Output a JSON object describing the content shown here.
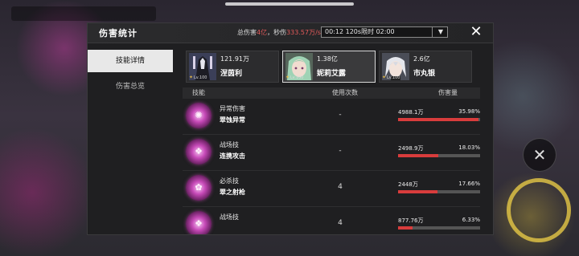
{
  "header": {
    "title": "伤害统计",
    "total_damage_label": "总伤害",
    "total_damage_value": "4亿",
    "dps_label": "，秒伤",
    "dps_value": "333.57万/s",
    "timer_option": "00:12 120s限时 02:00"
  },
  "sidebar": {
    "items": [
      {
        "label": "技能详情",
        "active": true
      },
      {
        "label": "伤害总览",
        "active": false
      }
    ]
  },
  "characters": [
    {
      "damage": "121.91万",
      "name": "涅茵利",
      "level": "Lv.100"
    },
    {
      "damage": "1.38亿",
      "name": "妮莉艾露",
      "level": "Lv.100"
    },
    {
      "damage": "2.6亿",
      "name": "市丸银",
      "level": "Lv.100"
    }
  ],
  "table": {
    "headers": {
      "skill": "技能",
      "uses": "使用次数",
      "damage": "伤害量"
    },
    "rows": [
      {
        "type": "异常伤害",
        "name": "翠蚀异常",
        "uses": "-",
        "damage": "4988.1万",
        "percent": "35.98%",
        "share": 0.3598
      },
      {
        "type": "战场技",
        "name": "连携攻击",
        "uses": "-",
        "damage": "2498.9万",
        "percent": "18.03%",
        "share": 0.1803
      },
      {
        "type": "必杀技",
        "name": "翠之射枪",
        "uses": "4",
        "damage": "2448万",
        "percent": "17.66%",
        "share": 0.1766
      },
      {
        "type": "战场技",
        "name": "",
        "uses": "4",
        "damage": "877.76万",
        "percent": "6.33%",
        "share": 0.0633
      }
    ]
  },
  "colors": {
    "bar": "#d83c3c",
    "highlight": "#e25a5a",
    "active_nav": "#e8e8e8"
  }
}
